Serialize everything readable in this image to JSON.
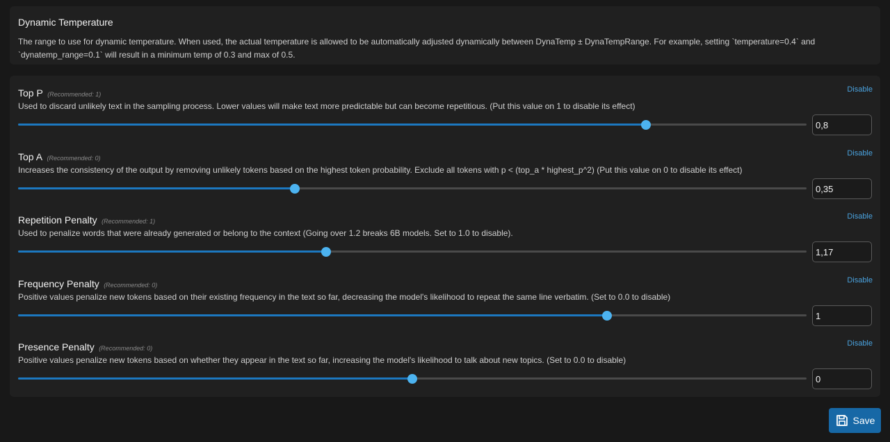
{
  "dynamic_temperature": {
    "title": "Dynamic Temperature",
    "description": "The range to use for dynamic temperature. When used, the actual temperature is allowed to be automatically adjusted dynamically between DynaTemp ± DynaTempRange. For example, setting `temperature=0.4` and `dynatemp_range=0.1` will result in a minimum temp of 0.3 and max of 0.5."
  },
  "params": [
    {
      "name": "Top P",
      "recommended": "(Recommended: 1)",
      "description": "Used to discard unlikely text in the sampling process. Lower values will make text more predictable but can become repetitious. (Put this value on 1 to disable its effect)",
      "disable_label": "Disable",
      "value": "0,8",
      "slider_fraction": 0.796
    },
    {
      "name": "Top A",
      "recommended": "(Recommended: 0)",
      "description": "Increases the consistency of the output by removing unlikely tokens based on the highest token probability. Exclude all tokens with p < (top_a * highest_p^2) (Put this value on 0 to disable its effect)",
      "disable_label": "Disable",
      "value": "0,35",
      "slider_fraction": 0.351
    },
    {
      "name": "Repetition Penalty",
      "recommended": "(Recommended: 1)",
      "description": "Used to penalize words that were already generated or belong to the context (Going over 1.2 breaks 6B models. Set to 1.0 to disable).",
      "disable_label": "Disable",
      "value": "1,17",
      "slider_fraction": 0.391
    },
    {
      "name": "Frequency Penalty",
      "recommended": "(Recommended: 0)",
      "description": "Positive values penalize new tokens based on their existing frequency in the text so far, decreasing the model's likelihood to repeat the same line verbatim. (Set to 0.0 to disable)",
      "disable_label": "Disable",
      "value": "1",
      "slider_fraction": 0.747
    },
    {
      "name": "Presence Penalty",
      "recommended": "(Recommended: 0)",
      "description": "Positive values penalize new tokens based on whether they appear in the text so far, increasing the model's likelihood to talk about new topics. (Set to 0.0 to disable)",
      "disable_label": "Disable",
      "value": "0",
      "slider_fraction": 0.5
    }
  ],
  "save_button": {
    "label": "Save",
    "icon": "floppy-disk-icon"
  },
  "colors": {
    "accent": "#1768a6",
    "slider_thumb": "#4cb3f0",
    "link": "#4aa3df"
  }
}
